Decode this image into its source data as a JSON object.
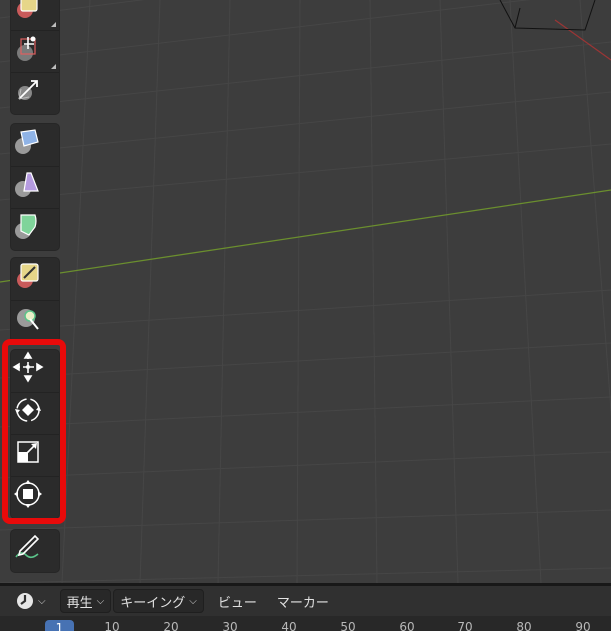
{
  "toolbar": {
    "tools_top": [
      {
        "icon": "annotate-tool-icon",
        "active": false
      },
      {
        "icon": "measure-tool-icon",
        "active": false
      },
      {
        "icon": "add-cube-tool-icon",
        "active": false
      }
    ],
    "tools_mid": [
      {
        "icon": "extrude-region-icon"
      },
      {
        "icon": "inset-faces-icon"
      },
      {
        "icon": "bevel-icon"
      }
    ],
    "tools_paint": [
      {
        "icon": "edit-tool-icon"
      },
      {
        "icon": "select-circle-icon"
      }
    ],
    "transform_tools": [
      {
        "icon": "move-icon"
      },
      {
        "icon": "rotate-icon"
      },
      {
        "icon": "scale-icon"
      },
      {
        "icon": "transform-icon"
      }
    ],
    "bottom_tool": {
      "icon": "annotate-pen-icon"
    }
  },
  "highlight_color": "#e80a0a",
  "timeline": {
    "editor_type_icon": "clock-icon",
    "menus": {
      "playback": "再生",
      "keying": "キーイング",
      "view": "ビュー",
      "marker": "マーカー"
    },
    "current_frame": "1",
    "ruler_ticks": [
      "10",
      "20",
      "30",
      "40",
      "50",
      "60",
      "70",
      "80",
      "90"
    ]
  }
}
